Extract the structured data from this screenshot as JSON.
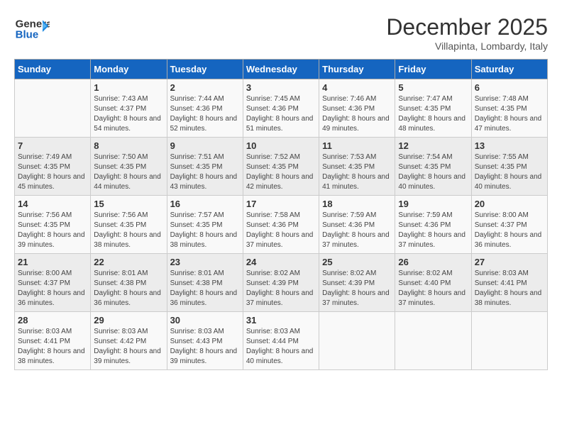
{
  "header": {
    "logo_general": "General",
    "logo_blue": "Blue",
    "month_title": "December 2025",
    "location": "Villapinta, Lombardy, Italy"
  },
  "days_of_week": [
    "Sunday",
    "Monday",
    "Tuesday",
    "Wednesday",
    "Thursday",
    "Friday",
    "Saturday"
  ],
  "weeks": [
    [
      {
        "day": "",
        "sunrise": "",
        "sunset": "",
        "daylight": ""
      },
      {
        "day": "1",
        "sunrise": "Sunrise: 7:43 AM",
        "sunset": "Sunset: 4:37 PM",
        "daylight": "Daylight: 8 hours and 54 minutes."
      },
      {
        "day": "2",
        "sunrise": "Sunrise: 7:44 AM",
        "sunset": "Sunset: 4:36 PM",
        "daylight": "Daylight: 8 hours and 52 minutes."
      },
      {
        "day": "3",
        "sunrise": "Sunrise: 7:45 AM",
        "sunset": "Sunset: 4:36 PM",
        "daylight": "Daylight: 8 hours and 51 minutes."
      },
      {
        "day": "4",
        "sunrise": "Sunrise: 7:46 AM",
        "sunset": "Sunset: 4:36 PM",
        "daylight": "Daylight: 8 hours and 49 minutes."
      },
      {
        "day": "5",
        "sunrise": "Sunrise: 7:47 AM",
        "sunset": "Sunset: 4:35 PM",
        "daylight": "Daylight: 8 hours and 48 minutes."
      },
      {
        "day": "6",
        "sunrise": "Sunrise: 7:48 AM",
        "sunset": "Sunset: 4:35 PM",
        "daylight": "Daylight: 8 hours and 47 minutes."
      }
    ],
    [
      {
        "day": "7",
        "sunrise": "Sunrise: 7:49 AM",
        "sunset": "Sunset: 4:35 PM",
        "daylight": "Daylight: 8 hours and 45 minutes."
      },
      {
        "day": "8",
        "sunrise": "Sunrise: 7:50 AM",
        "sunset": "Sunset: 4:35 PM",
        "daylight": "Daylight: 8 hours and 44 minutes."
      },
      {
        "day": "9",
        "sunrise": "Sunrise: 7:51 AM",
        "sunset": "Sunset: 4:35 PM",
        "daylight": "Daylight: 8 hours and 43 minutes."
      },
      {
        "day": "10",
        "sunrise": "Sunrise: 7:52 AM",
        "sunset": "Sunset: 4:35 PM",
        "daylight": "Daylight: 8 hours and 42 minutes."
      },
      {
        "day": "11",
        "sunrise": "Sunrise: 7:53 AM",
        "sunset": "Sunset: 4:35 PM",
        "daylight": "Daylight: 8 hours and 41 minutes."
      },
      {
        "day": "12",
        "sunrise": "Sunrise: 7:54 AM",
        "sunset": "Sunset: 4:35 PM",
        "daylight": "Daylight: 8 hours and 40 minutes."
      },
      {
        "day": "13",
        "sunrise": "Sunrise: 7:55 AM",
        "sunset": "Sunset: 4:35 PM",
        "daylight": "Daylight: 8 hours and 40 minutes."
      }
    ],
    [
      {
        "day": "14",
        "sunrise": "Sunrise: 7:56 AM",
        "sunset": "Sunset: 4:35 PM",
        "daylight": "Daylight: 8 hours and 39 minutes."
      },
      {
        "day": "15",
        "sunrise": "Sunrise: 7:56 AM",
        "sunset": "Sunset: 4:35 PM",
        "daylight": "Daylight: 8 hours and 38 minutes."
      },
      {
        "day": "16",
        "sunrise": "Sunrise: 7:57 AM",
        "sunset": "Sunset: 4:35 PM",
        "daylight": "Daylight: 8 hours and 38 minutes."
      },
      {
        "day": "17",
        "sunrise": "Sunrise: 7:58 AM",
        "sunset": "Sunset: 4:36 PM",
        "daylight": "Daylight: 8 hours and 37 minutes."
      },
      {
        "day": "18",
        "sunrise": "Sunrise: 7:59 AM",
        "sunset": "Sunset: 4:36 PM",
        "daylight": "Daylight: 8 hours and 37 minutes."
      },
      {
        "day": "19",
        "sunrise": "Sunrise: 7:59 AM",
        "sunset": "Sunset: 4:36 PM",
        "daylight": "Daylight: 8 hours and 37 minutes."
      },
      {
        "day": "20",
        "sunrise": "Sunrise: 8:00 AM",
        "sunset": "Sunset: 4:37 PM",
        "daylight": "Daylight: 8 hours and 36 minutes."
      }
    ],
    [
      {
        "day": "21",
        "sunrise": "Sunrise: 8:00 AM",
        "sunset": "Sunset: 4:37 PM",
        "daylight": "Daylight: 8 hours and 36 minutes."
      },
      {
        "day": "22",
        "sunrise": "Sunrise: 8:01 AM",
        "sunset": "Sunset: 4:38 PM",
        "daylight": "Daylight: 8 hours and 36 minutes."
      },
      {
        "day": "23",
        "sunrise": "Sunrise: 8:01 AM",
        "sunset": "Sunset: 4:38 PM",
        "daylight": "Daylight: 8 hours and 36 minutes."
      },
      {
        "day": "24",
        "sunrise": "Sunrise: 8:02 AM",
        "sunset": "Sunset: 4:39 PM",
        "daylight": "Daylight: 8 hours and 37 minutes."
      },
      {
        "day": "25",
        "sunrise": "Sunrise: 8:02 AM",
        "sunset": "Sunset: 4:39 PM",
        "daylight": "Daylight: 8 hours and 37 minutes."
      },
      {
        "day": "26",
        "sunrise": "Sunrise: 8:02 AM",
        "sunset": "Sunset: 4:40 PM",
        "daylight": "Daylight: 8 hours and 37 minutes."
      },
      {
        "day": "27",
        "sunrise": "Sunrise: 8:03 AM",
        "sunset": "Sunset: 4:41 PM",
        "daylight": "Daylight: 8 hours and 38 minutes."
      }
    ],
    [
      {
        "day": "28",
        "sunrise": "Sunrise: 8:03 AM",
        "sunset": "Sunset: 4:41 PM",
        "daylight": "Daylight: 8 hours and 38 minutes."
      },
      {
        "day": "29",
        "sunrise": "Sunrise: 8:03 AM",
        "sunset": "Sunset: 4:42 PM",
        "daylight": "Daylight: 8 hours and 39 minutes."
      },
      {
        "day": "30",
        "sunrise": "Sunrise: 8:03 AM",
        "sunset": "Sunset: 4:43 PM",
        "daylight": "Daylight: 8 hours and 39 minutes."
      },
      {
        "day": "31",
        "sunrise": "Sunrise: 8:03 AM",
        "sunset": "Sunset: 4:44 PM",
        "daylight": "Daylight: 8 hours and 40 minutes."
      },
      {
        "day": "",
        "sunrise": "",
        "sunset": "",
        "daylight": ""
      },
      {
        "day": "",
        "sunrise": "",
        "sunset": "",
        "daylight": ""
      },
      {
        "day": "",
        "sunrise": "",
        "sunset": "",
        "daylight": ""
      }
    ]
  ]
}
